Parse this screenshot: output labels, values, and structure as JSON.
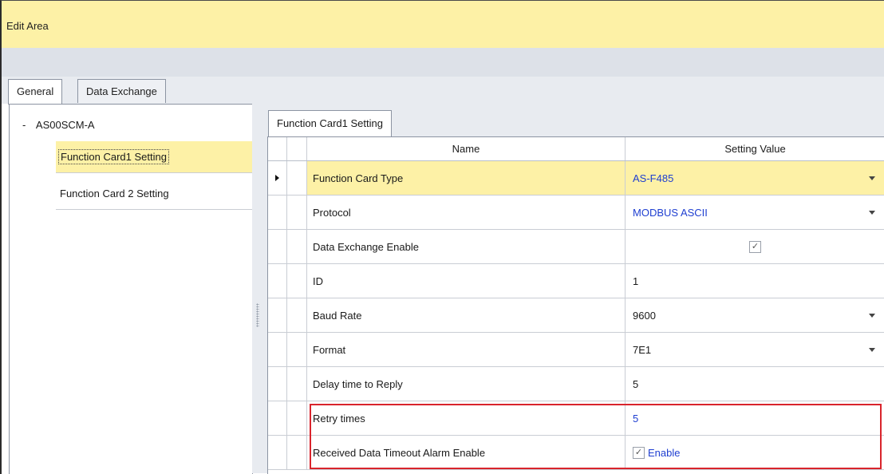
{
  "title_bar": {
    "title": "Edit Area"
  },
  "top_tabs": [
    {
      "label": "General"
    },
    {
      "label": "Data Exchange"
    }
  ],
  "tree": {
    "root": {
      "expander": "-",
      "label": "AS00SCM-A"
    },
    "items": [
      {
        "label": "Function Card1 Setting"
      },
      {
        "label": "Function Card 2 Setting"
      }
    ]
  },
  "right_tab": {
    "label": "Function Card1 Setting"
  },
  "grid": {
    "headers": {
      "name": "Name",
      "value": "Setting Value"
    },
    "rows": [
      {
        "name": "Function Card Type",
        "value": "AS-F485"
      },
      {
        "name": "Protocol",
        "value": "MODBUS ASCII"
      },
      {
        "name": "Data Exchange Enable",
        "value": ""
      },
      {
        "name": "ID",
        "value": "1"
      },
      {
        "name": "Baud Rate",
        "value": "9600"
      },
      {
        "name": "Format",
        "value": "7E1"
      },
      {
        "name": "Delay time to Reply",
        "value": "5"
      },
      {
        "name": "Retry times",
        "value": "5"
      },
      {
        "name": "Received Data Timeout Alarm Enable",
        "value": "Enable"
      }
    ]
  },
  "icons": {
    "checkmark": "check-icon",
    "dropdown": "chevron-down-icon",
    "row_indicator": "row-pointer-icon"
  },
  "colors": {
    "highlight": "#fdf1a6",
    "value_blue": "#1f3fd1",
    "annotation_red": "#d9242c"
  }
}
